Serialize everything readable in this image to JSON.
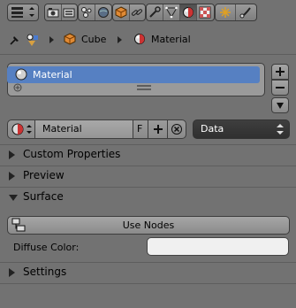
{
  "toolbar": {
    "editor_type_icon": "properties-editor-icon",
    "tabs": [
      {
        "name": "render-icon"
      },
      {
        "name": "render-layers-icon"
      },
      {
        "name": "scene-icon"
      },
      {
        "name": "world-icon"
      },
      {
        "name": "object-icon"
      },
      {
        "name": "constraints-icon"
      },
      {
        "name": "modifiers-icon"
      },
      {
        "name": "object-data-icon"
      },
      {
        "name": "material-icon"
      },
      {
        "name": "texture-icon"
      },
      {
        "name": "particles-icon"
      },
      {
        "name": "physics-icon"
      }
    ],
    "active_tab": "material-icon"
  },
  "breadcrumb": {
    "object": "Cube",
    "material": "Material"
  },
  "slots": {
    "items": [
      {
        "label": "Material"
      }
    ]
  },
  "datablock": {
    "name": "Material",
    "fake_user": "F",
    "link": "Data"
  },
  "sections": {
    "custom_properties": "Custom Properties",
    "preview": "Preview",
    "surface": "Surface",
    "settings": "Settings"
  },
  "surface": {
    "use_nodes_label": "Use Nodes",
    "diffuse_label": "Diffuse Color:",
    "diffuse_color": "#f0f0f0"
  },
  "colors": {
    "panel_bg": "#727272",
    "selection": "#5680c2",
    "dark_select": "#353535"
  }
}
